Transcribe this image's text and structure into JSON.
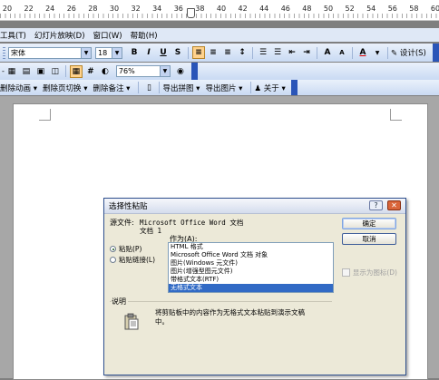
{
  "ruler": {
    "numbers": [
      "20",
      "22",
      "24",
      "26",
      "28",
      "30",
      "32",
      "34",
      "36",
      "38",
      "40",
      "42",
      "44",
      "46",
      "48",
      "50",
      "52",
      "54",
      "56",
      "58",
      "60"
    ]
  },
  "menu": {
    "items": [
      "工具(T)",
      "幻灯片放映(D)",
      "窗口(W)",
      "帮助(H)"
    ]
  },
  "toolbar1": {
    "font_name": "宋体",
    "font_size": "18",
    "bold": "B",
    "italic": "I",
    "underline": "U",
    "shadow": "S",
    "font_grow": "A",
    "font_shrink": "A",
    "design_label": "设计(S)"
  },
  "toolbar2": {
    "zoom": "76%"
  },
  "toolbar3": {
    "items": [
      "删除动画",
      "删除页切换",
      "删除备注",
      "导出拼图",
      "导出图片",
      "关于"
    ]
  },
  "dialog": {
    "title": "选择性粘贴",
    "source_label": "源文件:",
    "source_value": "Microsoft Office Word 文档",
    "source_doc": "文档 1",
    "as_label": "作为(A):",
    "paste_label": "粘贴(P)",
    "paste_link_label": "粘贴链接(L)",
    "list_items": [
      "HTML 格式",
      "Microsoft Office Word 文档 对象",
      "图片(Windows 元文件)",
      "图片(增强型图元文件)",
      "带格式文本(RTF)",
      "无格式文本"
    ],
    "selected_index": 5,
    "ok_label": "确定",
    "cancel_label": "取消",
    "display_icon_label": "显示为图标(D)",
    "description_label": "说明",
    "description_text": "将剪贴板中的内容作为无格式文本粘贴到演示文稿中。",
    "help_glyph": "?",
    "close_glyph": "✕"
  }
}
